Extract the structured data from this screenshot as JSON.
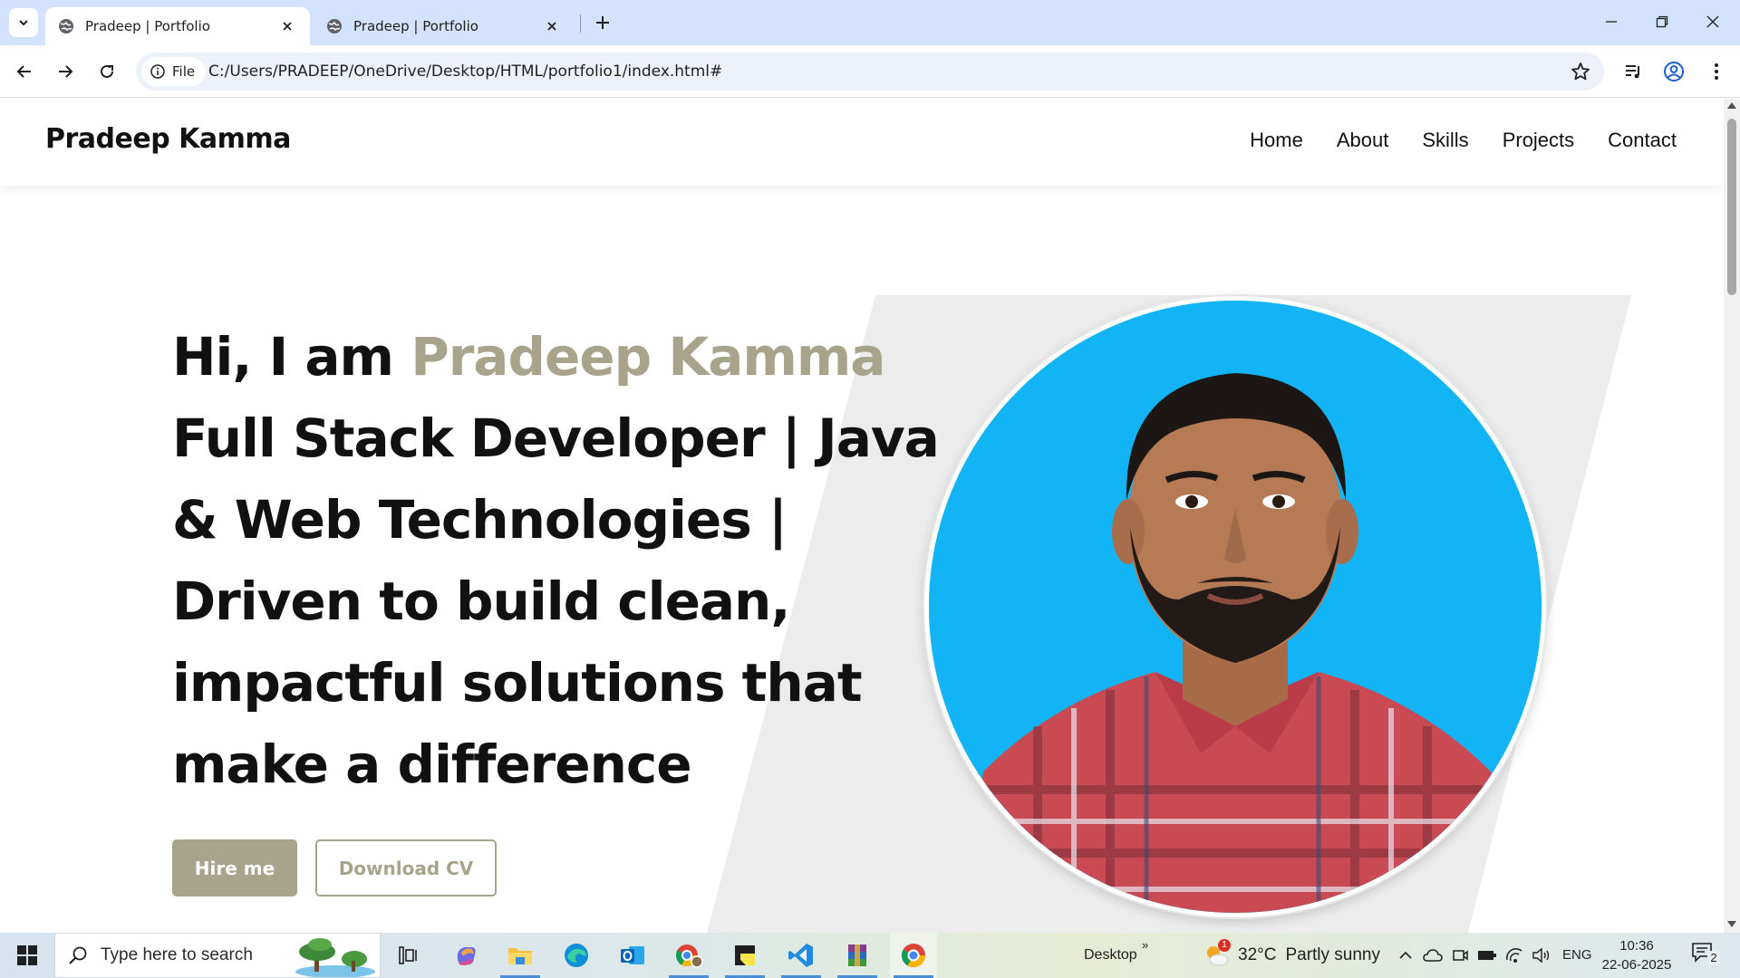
{
  "browser": {
    "tabs": [
      {
        "title": "Pradeep | Portfolio",
        "active": true
      },
      {
        "title": "Pradeep | Portfolio",
        "active": false
      }
    ],
    "address_chip": "File",
    "url": "C:/Users/PRADEEP/OneDrive/Desktop/HTML/portfolio1/index.html#"
  },
  "site": {
    "logo": "Pradeep Kamma",
    "nav": [
      "Home",
      "About",
      "Skills",
      "Projects",
      "Contact"
    ],
    "hero": {
      "greeting": "Hi, I am ",
      "name": "Pradeep Kamma",
      "lines": [
        "Full Stack Developer | Java",
        "& Web Technologies |",
        "Driven to build clean,",
        "impactful solutions that",
        "make a difference"
      ],
      "primary_button": "Hire me",
      "secondary_button": "Download CV"
    }
  },
  "taskbar": {
    "search_placeholder": "Type here to search",
    "desktop_label": "Desktop",
    "desktop_chevron": "»",
    "weather_temp": "32°C",
    "weather_desc": "Partly sunny",
    "weather_badge": "1",
    "language": "ENG",
    "time": "10:36",
    "date": "22-06-2025",
    "notification_count": "2",
    "apps": [
      "task-view",
      "copilot",
      "file-explorer",
      "edge",
      "outlook",
      "chrome-profile",
      "sticky-notes",
      "vscode",
      "winrar",
      "chrome"
    ]
  },
  "colors": {
    "accent": "#a8a48c",
    "tab_strip": "#d3e3fd",
    "omnibox": "#edf2fa",
    "hero_panel": "#ececec",
    "portrait_bg": "#12b4f5"
  }
}
